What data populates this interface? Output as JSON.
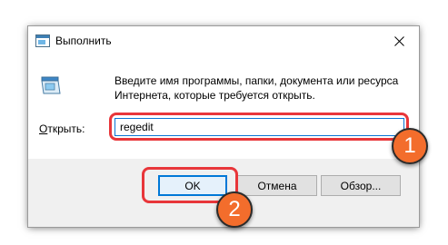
{
  "window": {
    "title": "Выполнить",
    "title_icon": "run-dialog-icon",
    "close_icon": "close-icon"
  },
  "content": {
    "icon": "run-icon",
    "description": "Введите имя программы, папки, документа или ресурса Интернета, которые требуется открыть.",
    "open_label_prefix": "О",
    "open_label_rest": "ткрыть:",
    "open_value": "regedit"
  },
  "buttons": {
    "ok": "OK",
    "cancel": "Отмена",
    "browse_prefix": "Обзор",
    "browse_suffix": "..."
  },
  "annotations": {
    "step1": "1",
    "step2": "2"
  },
  "colors": {
    "highlight": "#e8363a",
    "badge": "#f36d2c",
    "focus": "#0078d7"
  }
}
